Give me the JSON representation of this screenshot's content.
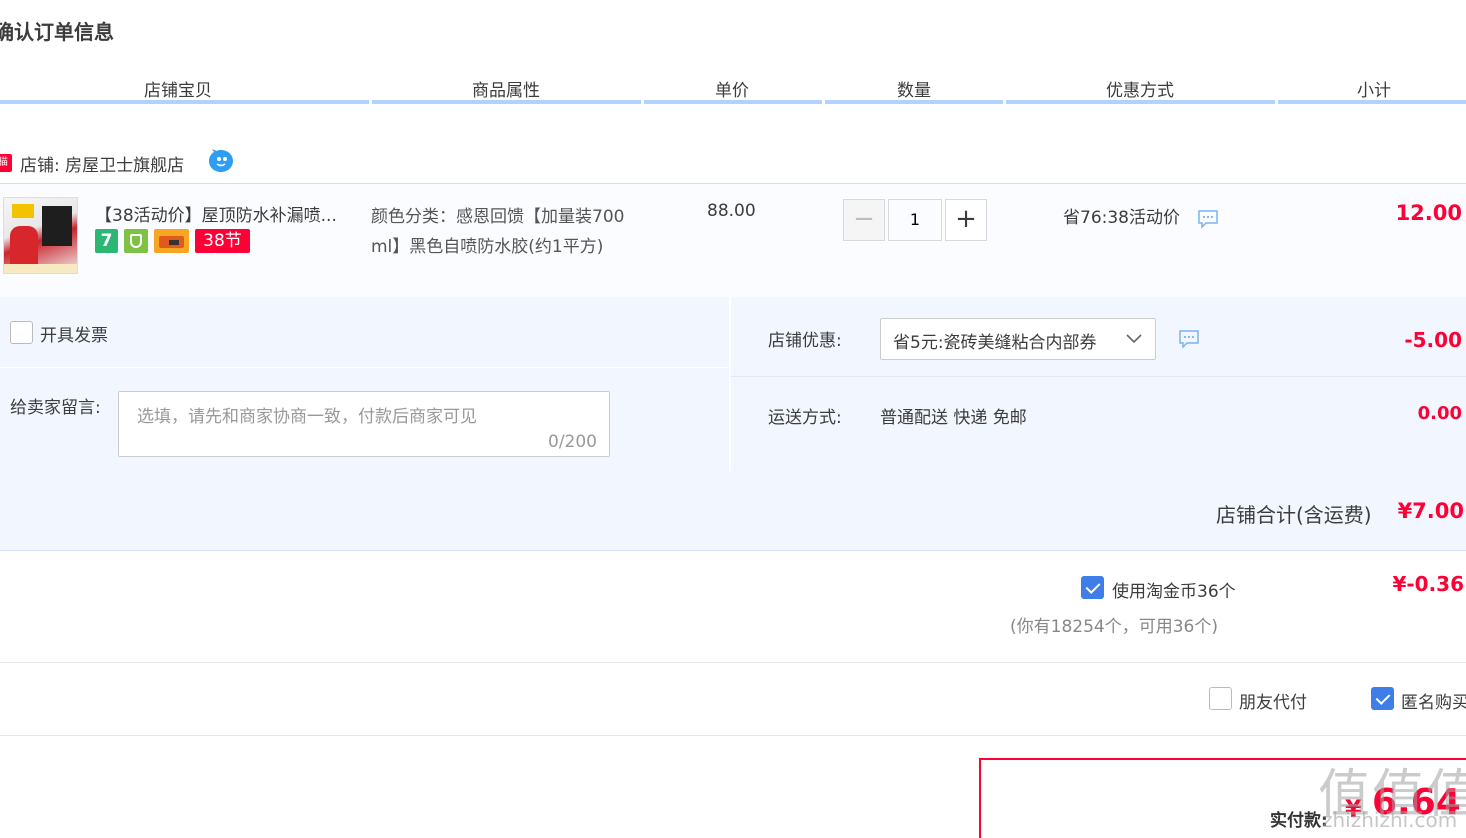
{
  "page_title": "确认订单信息",
  "columns": [
    "店铺宝贝",
    "商品属性",
    "单价",
    "数量",
    "优惠方式",
    "小计"
  ],
  "store": {
    "tmall_badge": "猫",
    "label": "店铺: 房屋卫士旗舰店"
  },
  "item": {
    "name": "【38活动价】屋顶防水补漏喷...",
    "badges": [
      "7",
      "38节"
    ],
    "attr_line1": "颜色分类：感恩回馈【加量装700",
    "attr_line2": "ml】黑色自喷防水胶(约1平方)",
    "price": "88.00",
    "qty_minus": "−",
    "qty": "1",
    "qty_plus": "+",
    "promo": "省76:38活动价",
    "subtotal": "12.00"
  },
  "invoice": {
    "label": "开具发票"
  },
  "message": {
    "label": "给卖家留言:",
    "placeholder": "选填，请先和商家协商一致，付款后商家可见",
    "count": "0/200"
  },
  "shop_discount": {
    "label": "店铺优惠:",
    "selected": "省5元:瓷砖美缝粘合内部券",
    "amount": "-5.00"
  },
  "shipping": {
    "label": "运送方式:",
    "value": "普通配送 快递 免邮",
    "amount": "0.00"
  },
  "store_total": {
    "label": "店铺合计(含运费)",
    "amount": "¥7.00"
  },
  "coins": {
    "label": "使用淘金币36个",
    "note": "(你有18254个，可用36个)",
    "amount": "¥-0.36"
  },
  "extras": {
    "friend_pay": "朋友代付",
    "anonymous": "匿名购买"
  },
  "pay": {
    "label": "实付款:",
    "currency": "¥",
    "amount": "6.64"
  },
  "watermark": {
    "logo": "值值值",
    "site": "zhizhizhi.com"
  },
  "colors": {
    "accent_red": "#ff0036",
    "header_bar": "#b2d1ff",
    "panel_bg": "#f2f7ff",
    "check_blue": "#3f7ee8"
  }
}
